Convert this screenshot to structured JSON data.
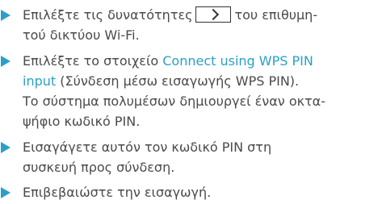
{
  "steps": [
    {
      "line1_before_icon": "Επιλέξτε τις δυνατότητες",
      "icon": "chevron-right-icon",
      "line1_after_icon": "του επιθυμη-",
      "line2": "τού δικτύου Wi-Fi."
    },
    {
      "line1_prefix": "Επιλέξτε το στοιχείο",
      "link_part1": "Connect using WPS PIN",
      "link_part2": "input",
      "line2_rest": "(Σύνδεση μέσω εισαγωγής WPS PIN).",
      "line3": "Το σύστημα πολυμέσων δημιουργεί έναν οκτα-",
      "line4": "ψήφιο κωδικό PIN."
    },
    {
      "line1": "Εισαγάγετε αυτόν τον κωδικό PIN στη",
      "line2": "συσκευή προς σύνδεση."
    },
    {
      "line1": "Επιβεβαιώστε την εισαγωγή."
    }
  ],
  "colors": {
    "accent": "#2aa0c8",
    "text": "#4a4a4a"
  }
}
